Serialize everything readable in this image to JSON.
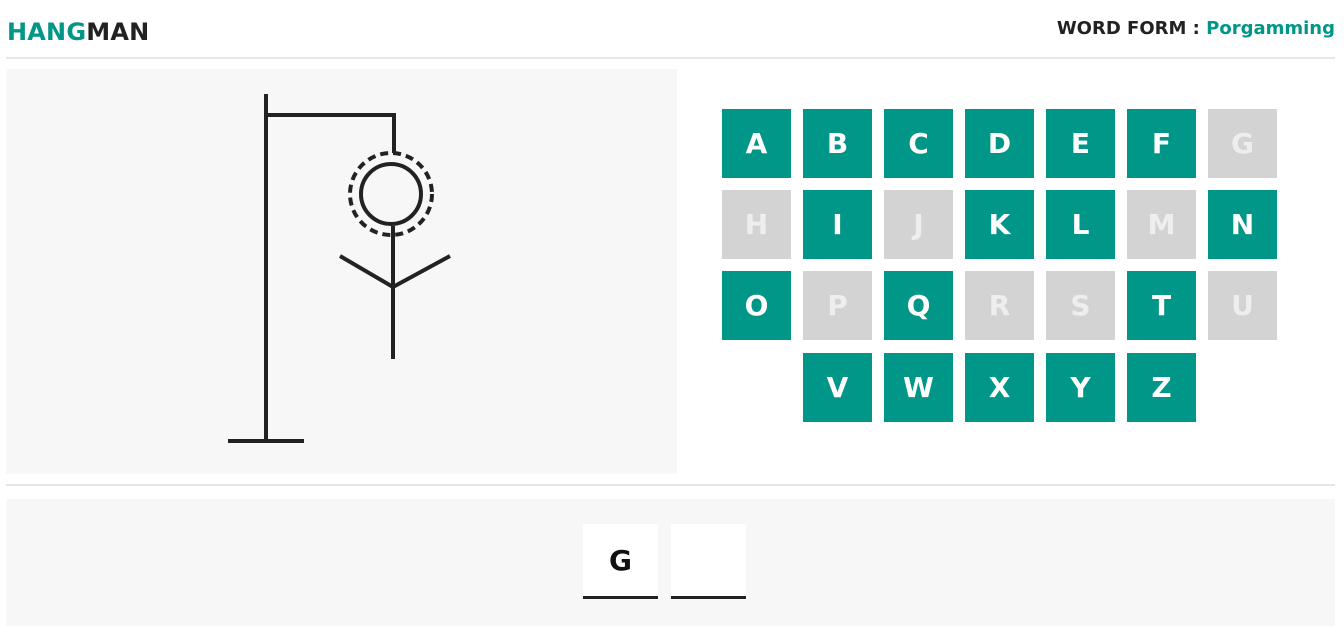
{
  "header": {
    "logo_part1": "HANG",
    "logo_part2": "MAN",
    "word_form_label": "WORD FORM : ",
    "word_form_value": "Porgamming"
  },
  "keyboard": {
    "rows": [
      [
        {
          "letter": "A",
          "used": false
        },
        {
          "letter": "B",
          "used": false
        },
        {
          "letter": "C",
          "used": false
        },
        {
          "letter": "D",
          "used": false
        },
        {
          "letter": "E",
          "used": false
        },
        {
          "letter": "F",
          "used": false
        },
        {
          "letter": "G",
          "used": true
        }
      ],
      [
        {
          "letter": "H",
          "used": true
        },
        {
          "letter": "I",
          "used": false
        },
        {
          "letter": "J",
          "used": true
        },
        {
          "letter": "K",
          "used": false
        },
        {
          "letter": "L",
          "used": false
        },
        {
          "letter": "M",
          "used": true
        },
        {
          "letter": "N",
          "used": false
        }
      ],
      [
        {
          "letter": "O",
          "used": false
        },
        {
          "letter": "P",
          "used": true
        },
        {
          "letter": "Q",
          "used": false
        },
        {
          "letter": "R",
          "used": true
        },
        {
          "letter": "S",
          "used": true
        },
        {
          "letter": "T",
          "used": false
        },
        {
          "letter": "U",
          "used": true
        }
      ],
      [
        {
          "letter": "V",
          "used": false
        },
        {
          "letter": "W",
          "used": false
        },
        {
          "letter": "X",
          "used": false
        },
        {
          "letter": "Y",
          "used": false
        },
        {
          "letter": "Z",
          "used": false
        }
      ]
    ]
  },
  "word": {
    "slots": [
      "G",
      ""
    ]
  },
  "colors": {
    "accent": "#009688",
    "used_key": "#d3d3d3",
    "panel": "#f7f7f7",
    "ink": "#222222"
  }
}
